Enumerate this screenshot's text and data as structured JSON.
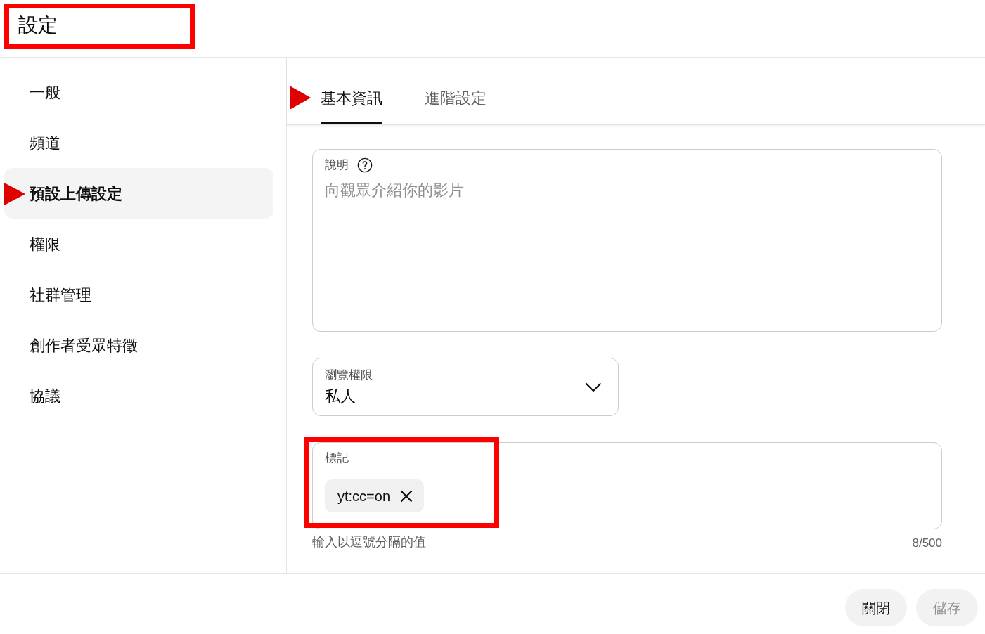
{
  "header": {
    "title": "設定",
    "highlight_frame": true
  },
  "sidebar": {
    "items": [
      {
        "label": "一般",
        "selected": false,
        "pointer_arrow": false
      },
      {
        "label": "頻道",
        "selected": false,
        "pointer_arrow": false
      },
      {
        "label": "預設上傳設定",
        "selected": true,
        "pointer_arrow": true
      },
      {
        "label": "權限",
        "selected": false,
        "pointer_arrow": false
      },
      {
        "label": "社群管理",
        "selected": false,
        "pointer_arrow": false
      },
      {
        "label": "創作者受眾特徵",
        "selected": false,
        "pointer_arrow": false
      },
      {
        "label": "協議",
        "selected": false,
        "pointer_arrow": false
      }
    ]
  },
  "tabs": [
    {
      "label": "基本資訊",
      "selected": true,
      "pointer_arrow": true
    },
    {
      "label": "進階設定",
      "selected": false,
      "pointer_arrow": false
    }
  ],
  "description": {
    "label": "說明",
    "placeholder": "向觀眾介紹你的影片"
  },
  "visibility": {
    "label": "瀏覽權限",
    "value": "私人"
  },
  "tags": {
    "label": "標記",
    "chips": [
      "yt:cc=on"
    ],
    "highlight_frame": true,
    "hint": "輸入以逗號分隔的值",
    "counter": "8/500"
  },
  "buttons": [
    {
      "label": "關閉",
      "disabled": false
    },
    {
      "label": "儲存",
      "disabled": true
    }
  ]
}
